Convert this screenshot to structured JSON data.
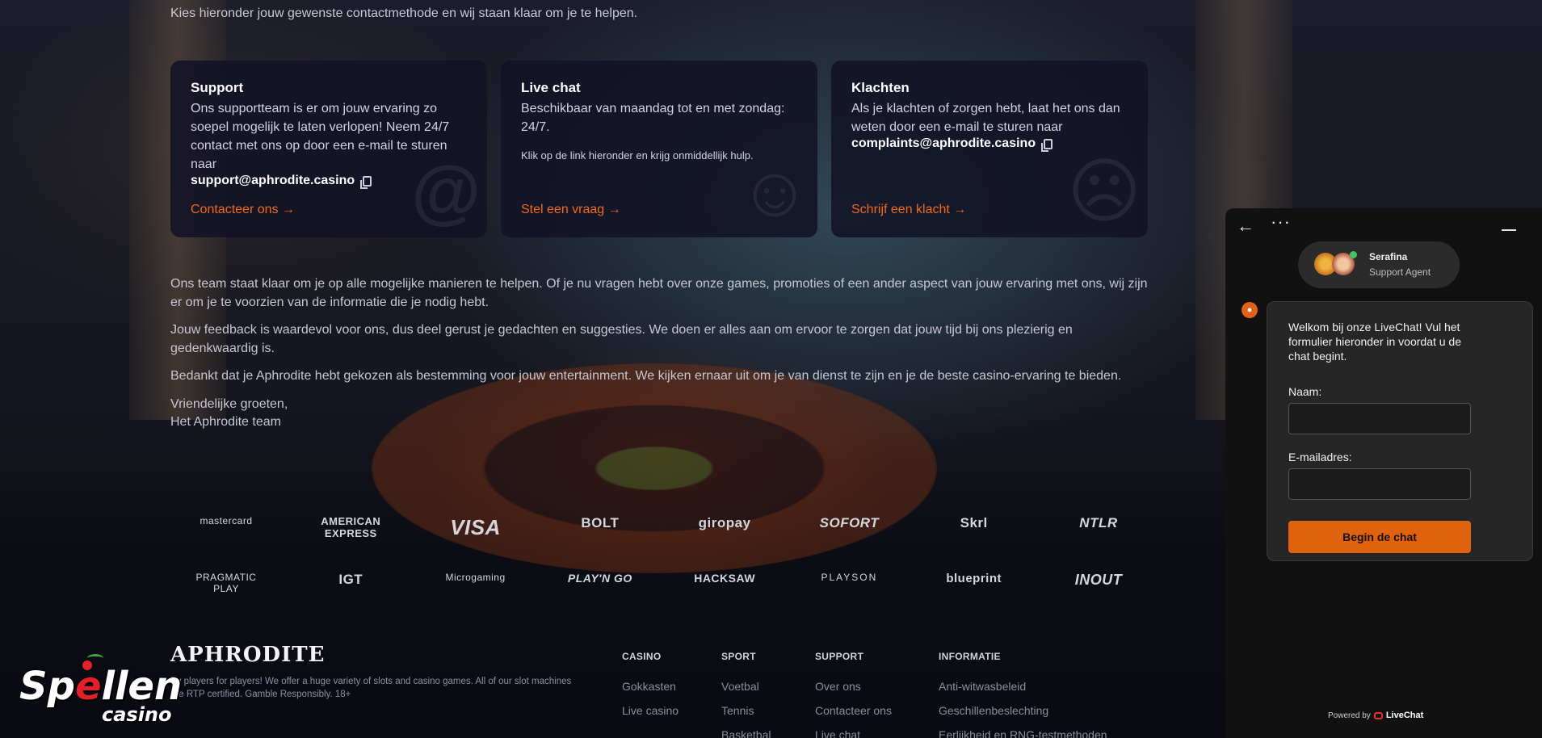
{
  "intro": "Kies hieronder jouw gewenste contactmethode en wij staan klaar om je te helpen.",
  "cards": {
    "support": {
      "title": "Support",
      "text": "Ons supportteam is er om jouw ervaring zo soepel mogelijk te laten verlopen! Neem 24/7 contact met ons op door een e-mail te sturen naar",
      "email": "support@aphrodite.casino",
      "link": "Contacteer ons →"
    },
    "livechat": {
      "title": "Live chat",
      "text": "Beschikbaar van maandag tot en met zondag: 24/7.",
      "small": "Klik op de link hieronder en krijg onmiddellijk hulp.",
      "link": "Stel een vraag →"
    },
    "complaints": {
      "title": "Klachten",
      "text": "Als je klachten of zorgen hebt, laat het ons dan weten door een e-mail te sturen naar",
      "email": "complaints@aphrodite.casino",
      "link": "Schrijf een klacht →"
    }
  },
  "body": {
    "p1": "Ons team staat klaar om je op alle mogelijke manieren te helpen. Of je nu vragen hebt over onze games, promoties of een ander aspect van jouw ervaring met ons, wij zijn er om je te voorzien van de informatie die je nodig hebt.",
    "p2": "Jouw feedback is waardevol voor ons, dus deel gerust je gedachten en suggesties. We doen er alles aan om ervoor te zorgen dat jouw tijd bij ons plezierig en gedenkwaardig is.",
    "p3": "Bedankt dat je Aphrodite hebt gekozen als bestemming voor jouw entertainment. We kijken ernaar uit om je van dienst te zijn en je de beste casino-ervaring te bieden.",
    "p4a": "Vriendelijke groeten,",
    "p4b": "Het Aphrodite team"
  },
  "payment_logos": [
    "mastercard",
    "AMERICAN EXPRESS",
    "VISA",
    "BOLT",
    "giropay",
    "SOFORT",
    "Skrl",
    "NTLR"
  ],
  "provider_logos": [
    "PRAGMATIC PLAY",
    "IGT",
    "Microgaming",
    "PLAY'N GO",
    "HACKSAW",
    "PLAYSON",
    "blueprint",
    "INOUT"
  ],
  "footer": {
    "brand": "APHRODITE",
    "desc": "By players for players! We offer a huge variety of slots and casino games. All of our slot machines are RTP certified. Gamble Responsibly. 18+",
    "columns": {
      "casino": {
        "title": "CASINO",
        "items": [
          "Gokkasten",
          "Live casino"
        ]
      },
      "sport": {
        "title": "SPORT",
        "items": [
          "Voetbal",
          "Tennis",
          "Basketbal"
        ]
      },
      "support": {
        "title": "SUPPORT",
        "items": [
          "Over ons",
          "Contacteer ons",
          "Live chat"
        ]
      },
      "info": {
        "title": "INFORMATIE",
        "items": [
          "Anti-witwasbeleid",
          "Geschillenbeslechting",
          "Eerlijkheid en RNG-testmethoden"
        ]
      }
    }
  },
  "watermark": {
    "main_a": "Sp",
    "main_red": "e",
    "main_b": "llen",
    "sub": "casino"
  },
  "chat": {
    "agent_name": "Serafina",
    "agent_role": "Support Agent",
    "welcome": "Welkom bij onze LiveChat! Vul het formulier hieronder in voordat u de chat begint.",
    "name_label": "Naam:",
    "email_label": "E-mailadres:",
    "name_value": "",
    "email_value": "",
    "start_button": "Begin de chat",
    "powered_by": "Powered by",
    "powered_brand": "LiveChat"
  },
  "colors": {
    "accent": "#f06a1a",
    "chat_button": "#e1620e",
    "online": "#43c463"
  }
}
